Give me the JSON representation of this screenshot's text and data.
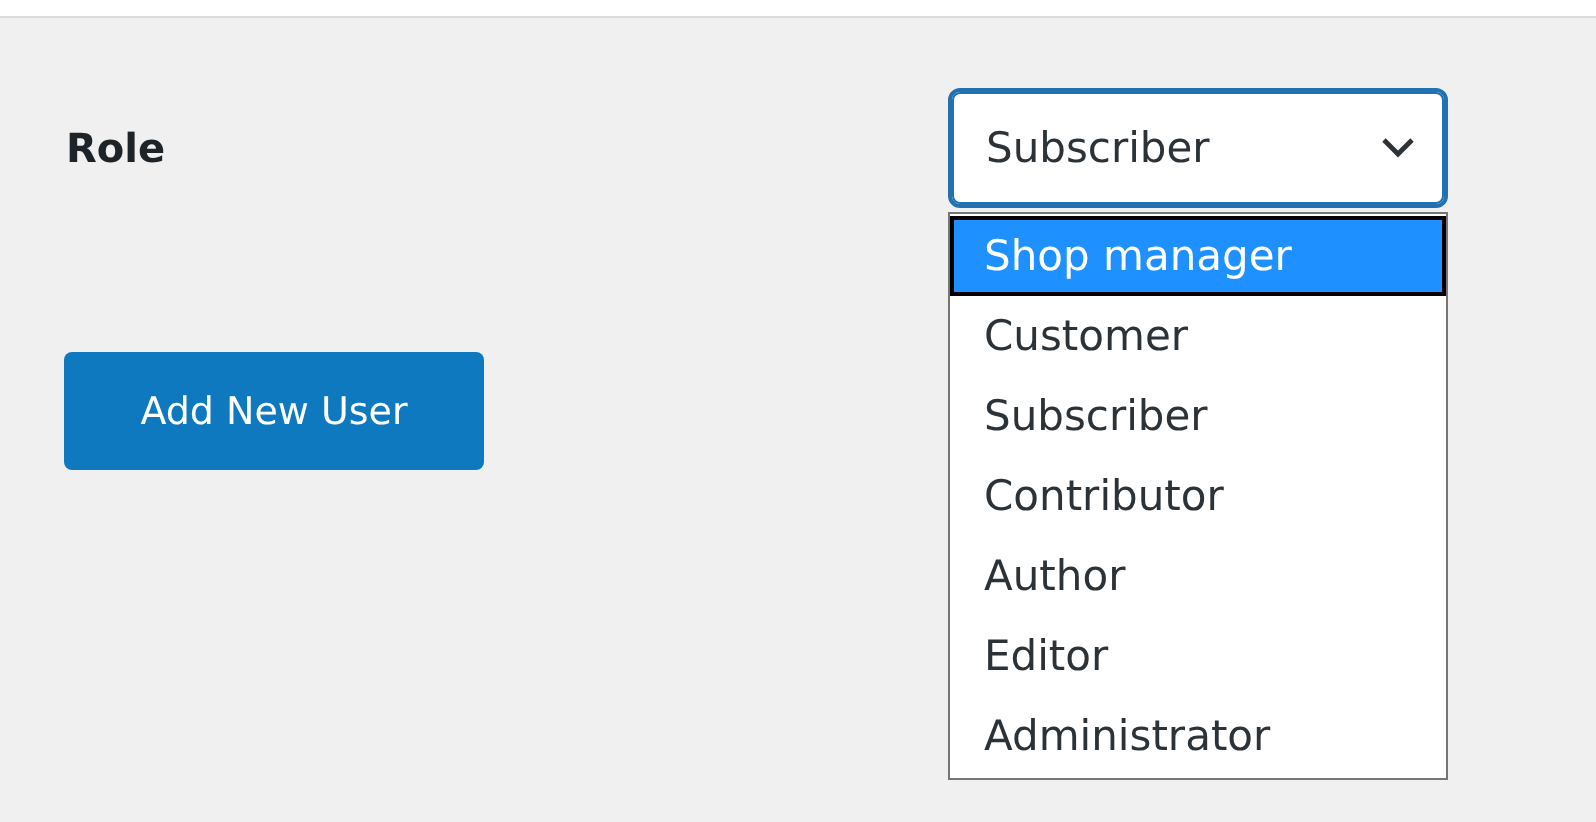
{
  "role_field": {
    "label": "Role",
    "value": "Subscriber",
    "expanded": true
  },
  "options": [
    {
      "label": "Shop manager",
      "selected": true
    },
    {
      "label": "Customer",
      "selected": false
    },
    {
      "label": "Subscriber",
      "selected": false
    },
    {
      "label": "Contributor",
      "selected": false
    },
    {
      "label": "Author",
      "selected": false
    },
    {
      "label": "Editor",
      "selected": false
    },
    {
      "label": "Administrator",
      "selected": false
    }
  ],
  "button": "Add New User"
}
